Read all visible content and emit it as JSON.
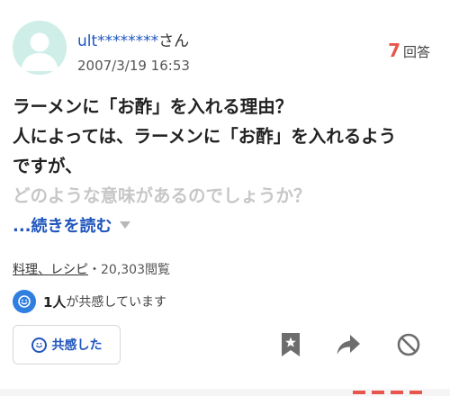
{
  "user": {
    "name": "ult********",
    "suffix": "さん",
    "date": "2007/3/19 16:53"
  },
  "answers": {
    "count": "7",
    "label": "回答"
  },
  "question": {
    "lines": [
      "ラーメンに「お酢」を入れる理由？",
      "人によっては、ラーメンに「お酢」を入れるよう",
      "ですが、",
      "どのような意味があるのでしょうか？"
    ]
  },
  "readmore": {
    "label": "...続きを読む"
  },
  "meta": {
    "category": "料理、レシピ",
    "separator": "・",
    "views": "20,303閲覧"
  },
  "empathy": {
    "count": "1人",
    "text": "が共感しています",
    "button_label": "共感した"
  },
  "icons": {
    "avatar": "user-avatar-icon",
    "readmore_caret": "caret-down-icon",
    "empathy_badge": "smiley-icon",
    "bookmark": "bookmark-star-icon",
    "share": "share-arrow-icon",
    "block": "prohibit-icon"
  },
  "colors": {
    "link": "#1f55bd",
    "answer_count": "#e8554c",
    "avatar_bg": "#cfeee7",
    "empathy_badge": "#2f7ee0"
  }
}
